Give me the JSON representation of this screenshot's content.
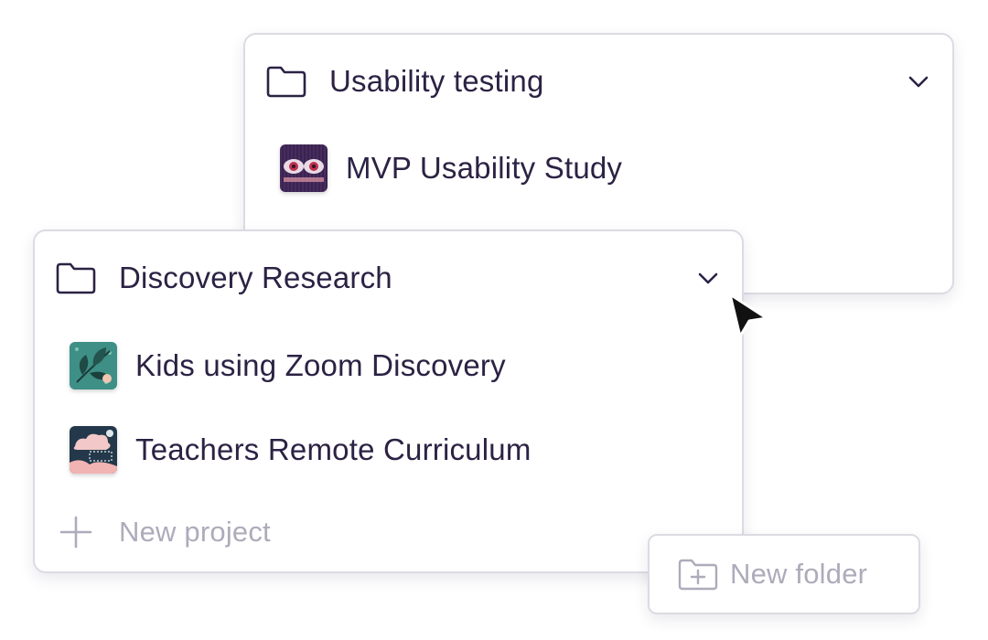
{
  "folders": [
    {
      "title": "Usability testing",
      "projects": [
        {
          "name": "MVP Usability Study",
          "thumb": "eyes-illustration"
        }
      ]
    },
    {
      "title": "Discovery Research",
      "projects": [
        {
          "name": "Kids using Zoom Discovery",
          "thumb": "leaf-illustration"
        },
        {
          "name": "Teachers Remote Curriculum",
          "thumb": "cloud-illustration"
        }
      ],
      "new_project_label": "New project"
    }
  ],
  "new_folder_label": "New folder",
  "icons": {
    "folder": "folder-icon",
    "expand": "chevron-down-icon",
    "add": "plus-icon",
    "add_folder": "folder-plus-icon",
    "pointer": "mouse-pointer-icon"
  },
  "colors": {
    "text": "#2c2244",
    "muted": "#aeabbb",
    "border": "#dcdbe3"
  }
}
